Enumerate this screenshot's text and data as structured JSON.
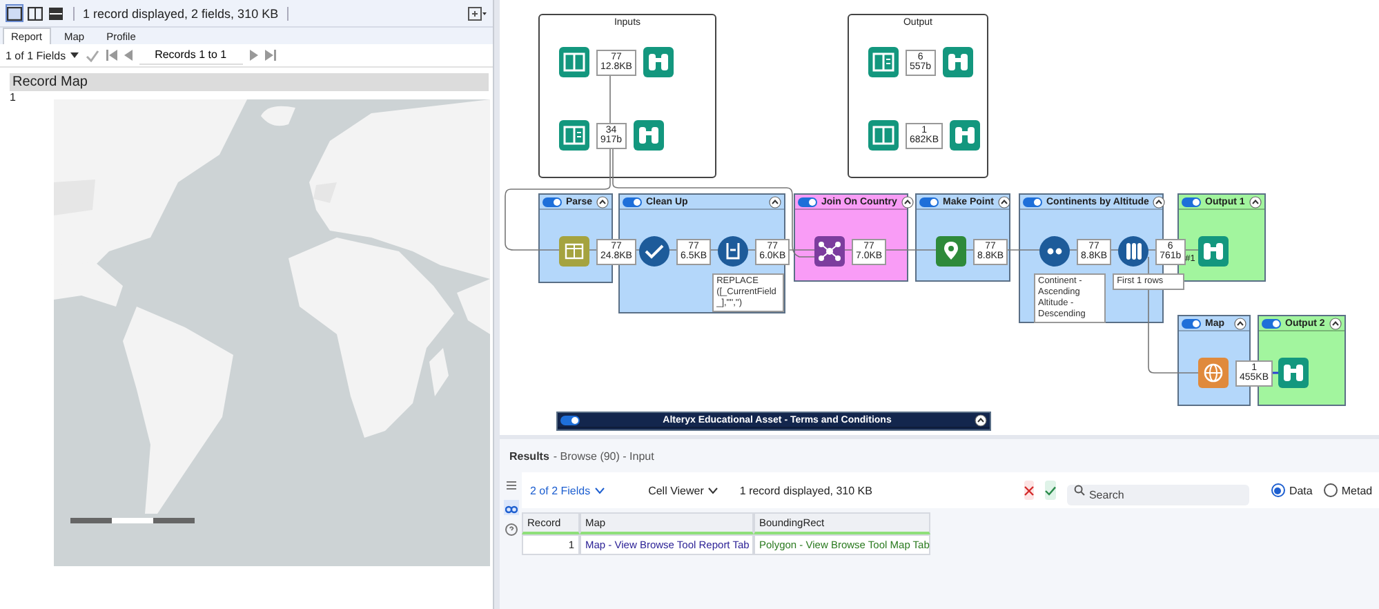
{
  "viewer": {
    "layout_buttons": [
      {
        "kind": "single",
        "selected": true
      },
      {
        "kind": "columns",
        "selected": false
      },
      {
        "kind": "rows",
        "selected": false
      }
    ],
    "status": "1 record displayed, 2 fields, 310 KB",
    "tabs": [
      {
        "label": "Report",
        "selected": true
      },
      {
        "label": "Map",
        "selected": false
      },
      {
        "label": "Profile",
        "selected": false
      }
    ],
    "fields_dropdown": "1 of 1 Fields",
    "records": "Records 1 to 1",
    "report": {
      "title": "Record Map",
      "row": "1"
    }
  },
  "canvas": {
    "containers": [
      {
        "kind": "group",
        "title": "Inputs",
        "color": "#ffffff",
        "rows": [
          [
            {
              "kind": "input"
            },
            {
              "kind": "count",
              "records": "77",
              "size": "12.8KB"
            },
            {
              "kind": "browse"
            }
          ],
          [
            {
              "kind": "text-input"
            },
            {
              "kind": "count",
              "records": "34",
              "size": "917b"
            },
            {
              "kind": "browse"
            }
          ]
        ]
      },
      {
        "kind": "group",
        "title": "Output",
        "color": "#ffffff",
        "rows": [
          [
            {
              "kind": "text-input"
            },
            {
              "kind": "count",
              "records": "6",
              "size": "557b"
            },
            {
              "kind": "browse"
            }
          ],
          [
            {
              "kind": "input"
            },
            {
              "kind": "count",
              "records": "1",
              "size": "682KB"
            },
            {
              "kind": "browse"
            }
          ]
        ]
      },
      {
        "kind": "container",
        "title": "Parse",
        "color": "#b4d7fa",
        "enabled": true,
        "rows": [
          [
            {
              "kind": "parse"
            },
            {
              "kind": "count",
              "records": "77",
              "size": "24.8KB"
            }
          ]
        ]
      },
      {
        "kind": "container",
        "title": "Clean Up",
        "color": "#b4d7fa",
        "enabled": true,
        "rows": [
          [
            {
              "kind": "select"
            },
            {
              "kind": "count",
              "records": "77",
              "size": "6.5KB"
            },
            {
              "kind": "formula",
              "note": "REPLACE ([_CurrentField_],'\"','')"
            },
            {
              "kind": "count",
              "records": "77",
              "size": "6.0KB"
            }
          ]
        ]
      },
      {
        "kind": "container",
        "title": "Join On Country",
        "color": "#f99cf6",
        "enabled": true,
        "rows": [
          [
            {
              "kind": "join"
            },
            {
              "kind": "count",
              "records": "77",
              "size": "7.0KB"
            }
          ]
        ]
      },
      {
        "kind": "container",
        "title": "Make Point",
        "color": "#b4d7fa",
        "enabled": true,
        "rows": [
          [
            {
              "kind": "create-points"
            },
            {
              "kind": "count",
              "records": "77",
              "size": "8.8KB"
            }
          ]
        ]
      },
      {
        "kind": "container",
        "title": "Continents by Altitude",
        "color": "#b4d7fa",
        "enabled": true,
        "rows": [
          [
            {
              "kind": "sort",
              "note": "Continent - Ascending Altitude - Descending"
            },
            {
              "kind": "count",
              "records": "77",
              "size": "8.8KB"
            },
            {
              "kind": "sample",
              "note": "First 1 rows"
            },
            {
              "kind": "count",
              "records": "6",
              "size": "761b",
              "tag": "#1"
            }
          ]
        ]
      },
      {
        "kind": "container",
        "title": "Output 1",
        "color": "#a2f59e",
        "enabled": true,
        "rows": [
          [
            {
              "kind": "browse"
            }
          ]
        ]
      },
      {
        "kind": "container",
        "title": "Map",
        "color": "#b4d7fa",
        "enabled": true,
        "rows": [
          [
            {
              "kind": "map"
            },
            {
              "kind": "count",
              "records": "1",
              "size": "455KB"
            }
          ]
        ]
      },
      {
        "kind": "container",
        "title": "Output 2",
        "color": "#a2f59e",
        "enabled": true,
        "rows": [
          [
            {
              "kind": "browse"
            }
          ]
        ]
      },
      {
        "kind": "container",
        "title": "Alteryx Educational Asset - Terms and Conditions",
        "color": "#13264d",
        "enabled": true
      }
    ]
  },
  "results": {
    "title": "Results",
    "subtitle": "- Browse (90) - Input",
    "side_icons": [
      {
        "kind": "list",
        "selected": false
      },
      {
        "kind": "browse",
        "selected": true
      },
      {
        "kind": "help",
        "selected": false
      }
    ],
    "fields_dropdown": "2 of 2 Fields",
    "viewer_dropdown": "Cell Viewer",
    "status": "1 record displayed, 310 KB",
    "search": {
      "placeholder": "Search"
    },
    "modes": [
      {
        "label": "Data",
        "selected": true
      },
      {
        "label": "Metad",
        "selected": false
      }
    ],
    "table": {
      "columns": [
        "Record",
        "Map",
        "BoundingRect"
      ],
      "rows": [
        [
          "1",
          "Map - View Browse Tool Report Tab",
          "Polygon - View Browse Tool Map Tab"
        ]
      ]
    }
  }
}
